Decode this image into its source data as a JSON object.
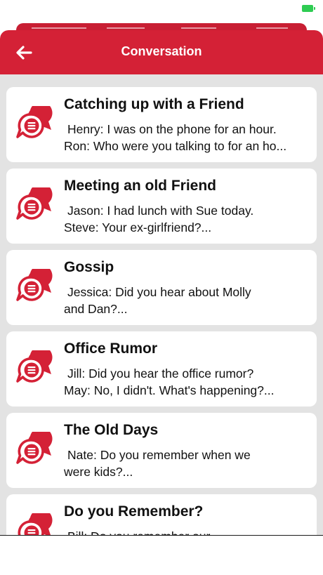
{
  "colors": {
    "accent": "#d42136",
    "sheet_bg": "#e3e3e3",
    "card_bg": "#ffffff",
    "battery": "#2ecc52"
  },
  "status_bar": {
    "battery_icon": "battery-charging-icon"
  },
  "navbar": {
    "back_icon": "arrow-left-icon",
    "title": "Conversation"
  },
  "conversations": [
    {
      "title": "Catching up with a Friend",
      "preview_line1": "Henry: I was on the phone for an hour.",
      "preview_line2": "Ron: Who were you talking to for an ho...",
      "icon": "chat-bubbles-icon"
    },
    {
      "title": "Meeting an old Friend",
      "preview_line1": "Jason: I had lunch with Sue today.",
      "preview_line2": "Steve: Your ex-girlfriend?...",
      "icon": "chat-bubbles-icon"
    },
    {
      "title": "Gossip",
      "preview_line1": "Jessica: Did you hear about Molly",
      "preview_line2": "and Dan?...",
      "icon": "chat-bubbles-icon"
    },
    {
      "title": "Office Rumor",
      "preview_line1": "Jill: Did you hear the office rumor?",
      "preview_line2": "May: No, I didn't. What's happening?...",
      "icon": "chat-bubbles-icon"
    },
    {
      "title": "The Old Days",
      "preview_line1": "Nate: Do you remember when we",
      "preview_line2": "were kids?...",
      "icon": "chat-bubbles-icon"
    },
    {
      "title": "Do you Remember?",
      "preview_line1": "Bill: Do you remember our",
      "preview_line2": "",
      "icon": "chat-bubbles-icon"
    }
  ]
}
